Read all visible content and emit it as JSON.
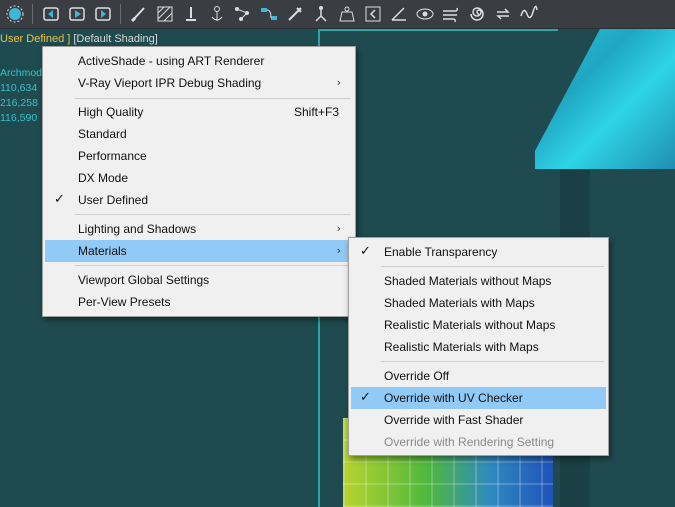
{
  "toolbar": {
    "icons": [
      "select-object-icon",
      "undo-scene-icon",
      "play-icon",
      "redo-scene-icon",
      "brush-icon",
      "hatch-icon",
      "pin-icon",
      "anchor-icon",
      "graph-icon",
      "node-editor-icon",
      "wand-icon",
      "rig-icon",
      "weight-icon",
      "back-icon",
      "angle-icon",
      "eye-icon",
      "wind-icon",
      "vortex-icon",
      "cycle-icon",
      "wave-icon"
    ]
  },
  "viewport": {
    "label_user": "User Defined",
    "label_bracket": " ] ",
    "label_shading": "[Default Shading]",
    "stats": [
      "Archmod",
      "110,634",
      "216,258",
      "116,590"
    ]
  },
  "menu_main": {
    "items": [
      {
        "label": "ActiveShade - using ART Renderer",
        "checked": false,
        "submenu": false,
        "shortcut": ""
      },
      {
        "label": "V-Ray Vieport IPR Debug Shading",
        "checked": false,
        "submenu": true,
        "shortcut": ""
      },
      {
        "label": "High Quality",
        "checked": false,
        "submenu": false,
        "shortcut": "Shift+F3"
      },
      {
        "label": "Standard",
        "checked": false,
        "submenu": false,
        "shortcut": ""
      },
      {
        "label": "Performance",
        "checked": false,
        "submenu": false,
        "shortcut": ""
      },
      {
        "label": "DX Mode",
        "checked": false,
        "submenu": false,
        "shortcut": ""
      },
      {
        "label": "User Defined",
        "checked": true,
        "submenu": false,
        "shortcut": ""
      },
      {
        "label": "Lighting and Shadows",
        "checked": false,
        "submenu": true,
        "shortcut": ""
      },
      {
        "label": "Materials",
        "checked": false,
        "submenu": true,
        "shortcut": "",
        "highlighted": true
      },
      {
        "label": "Viewport Global Settings",
        "checked": false,
        "submenu": false,
        "shortcut": ""
      },
      {
        "label": "Per-View Presets",
        "checked": false,
        "submenu": false,
        "shortcut": ""
      }
    ]
  },
  "menu_materials": {
    "items": [
      {
        "label": "Enable Transparency",
        "checked": true
      },
      {
        "label": "Shaded Materials without Maps",
        "checked": false
      },
      {
        "label": "Shaded Materials with Maps",
        "checked": false
      },
      {
        "label": "Realistic Materials without Maps",
        "checked": false
      },
      {
        "label": "Realistic Materials with Maps",
        "checked": false
      },
      {
        "label": "Override Off",
        "checked": false
      },
      {
        "label": "Override with UV Checker",
        "checked": true,
        "highlighted": true
      },
      {
        "label": "Override with Fast Shader",
        "checked": false
      },
      {
        "label": "Override with Rendering Setting",
        "checked": false,
        "disabled": true
      }
    ]
  },
  "glyphs": {
    "check": "✓",
    "arrow": "›"
  }
}
